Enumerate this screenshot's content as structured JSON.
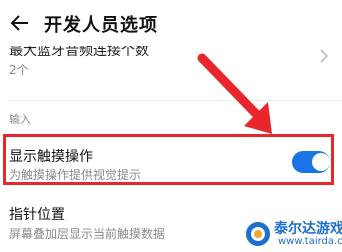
{
  "appbar": {
    "title": "开发人员选项",
    "back_icon": "arrow-left-icon"
  },
  "previous_row": {
    "title": "最大蓝牙音频连接个数",
    "value": "2个",
    "chevron_icon": "chevron-right-icon"
  },
  "section": {
    "header": "输入"
  },
  "rows": [
    {
      "title": "显示触摸操作",
      "subtitle": "为触摸操作提供视觉提示",
      "toggle_on": true,
      "highlighted": true
    },
    {
      "title": "指针位置",
      "subtitle": "屏幕叠加层显示当前触摸数据"
    }
  ],
  "watermark": {
    "site_name": "泰尔达游戏网",
    "url": "www.tairda.com"
  },
  "colors": {
    "accent": "#1b74e6",
    "annotation": "#e8262b",
    "watermark": "#1f6fd1"
  }
}
